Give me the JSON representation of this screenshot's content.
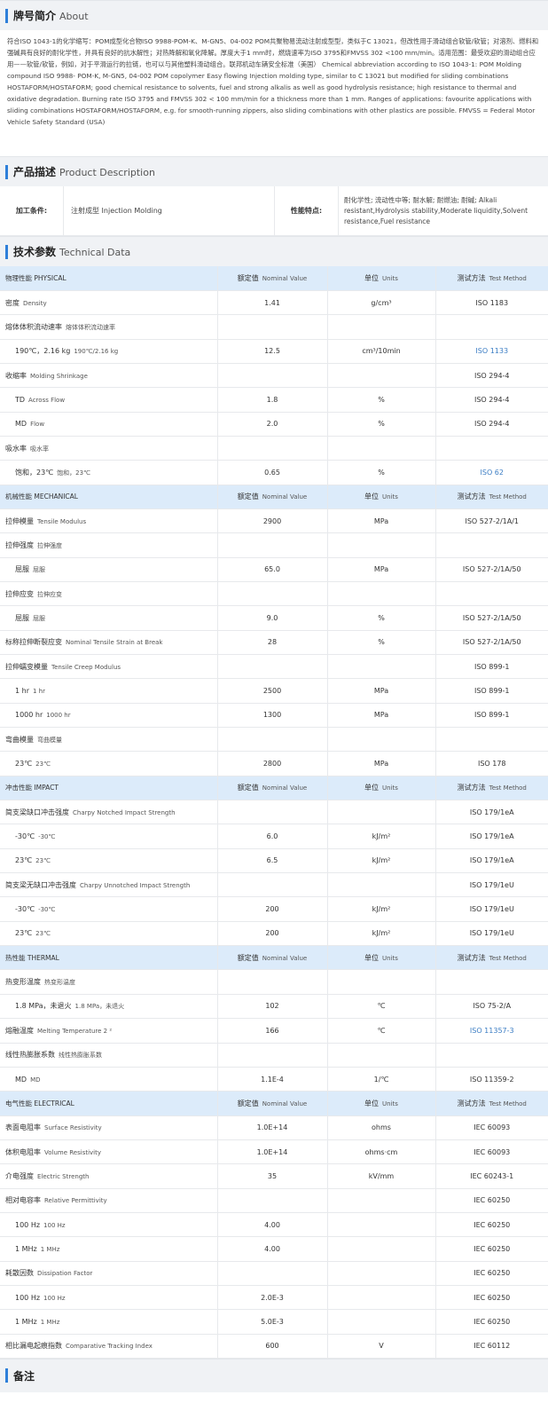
{
  "about": {
    "title": "牌号简介",
    "title_en": "About",
    "text_zh": "符合ISO 1043-1的化学缩写：POM成型化合物ISO 9988-POM-K、M-GN5、04-002 POM共聚物易流动注射成型型，类似于C 13021，但改性用于滑动组合软管/软管；对溶剂、燃料和强碱具有良好的耐化学性，并具有良好的抗水解性；对热降解和氧化降解。厚度大于1 mm时，燃烧速率为ISO 3795和FMVSS 302 <100 mm/min。适用范围：最受欢迎的滑动组合应用——软管/软管，例如，对于平滑运行的拉链，也可以与其他塑料滑动组合。联邦机动车辆安全标准（美国）",
    "text_en": "Chemical abbreviation according to ISO 1043-1: POM Molding compound ISO 9988- POM-K, M-GN5, 04-002 POM copolymer Easy flowing Injection molding type, similar to C 13021 but modified for sliding combinations HOSTAFORM/HOSTAFORM; good chemical resistance to solvents, fuel and strong alkalis as well as good hydrolysis resistance; high resistance to thermal and oxidative degradation. Burning rate ISO 3795 and FMVSS 302 < 100 mm/min for a thickness more than 1 mm. Ranges of applications: favourite applications with sliding combinations HOSTAFORM/HOSTAFORM, e.g. for smooth-running zippers, also sliding combinations with other plastics are possible. FMVSS = Federal Motor Vehicle Safety Standard (USA)"
  },
  "product": {
    "title": "产品描述",
    "title_en": "Product Description",
    "proc_label": "加工条件:",
    "proc_value": "注射成型  Injection Molding",
    "perf_label": "性能特点:",
    "perf_value": "耐化学性; 流动性中等; 耐水解; 耐燃油; 耐碱;  Alkali resistant,Hydrolysis stability,Moderate liquidity,Solvent resistance,Fuel resistance"
  },
  "tech": {
    "title": "技术参数",
    "title_en": "Technical Data",
    "rows": [
      {
        "type": "hdr",
        "c1": "物理性能  PHYSICAL",
        "c2": "额定值",
        "c2en": "Nominal Value",
        "c3": "单位",
        "c3en": "Units",
        "c4": "测试方法",
        "c4en": "Test Method"
      },
      {
        "c1": "密度",
        "c1en": "Density",
        "c2": "1.41",
        "c3": "g/cm³",
        "c4": "ISO 1183"
      },
      {
        "c1": "熔体体积流动速率",
        "c1en": "熔体体积流动速率",
        "c2": "",
        "c3": "",
        "c4": ""
      },
      {
        "ind": true,
        "c1": "190℃，2.16 kg",
        "c1en": "190℃/2.16 kg",
        "c2": "12.5",
        "c3": "cm³/10min",
        "c4": "ISO 1133",
        "link": true
      },
      {
        "c1": "收缩率",
        "c1en": "Molding Shrinkage",
        "c2": "",
        "c3": "",
        "c4": "ISO 294-4"
      },
      {
        "ind": true,
        "c1": "TD",
        "c1en": "Across Flow",
        "c2": "1.8",
        "c3": "%",
        "c4": "ISO 294-4"
      },
      {
        "ind": true,
        "c1": "MD",
        "c1en": "Flow",
        "c2": "2.0",
        "c3": "%",
        "c4": "ISO 294-4"
      },
      {
        "c1": "吸水率",
        "c1en": "吸水率",
        "c2": "",
        "c3": "",
        "c4": ""
      },
      {
        "ind": true,
        "c1": "饱和，23℃",
        "c1en": "饱和，23℃",
        "c2": "0.65",
        "c3": "%",
        "c4": "ISO 62",
        "link": true
      },
      {
        "type": "hdr",
        "c1": "机械性能  MECHANICAL",
        "c2": "额定值",
        "c2en": "Nominal Value",
        "c3": "单位",
        "c3en": "Units",
        "c4": "测试方法",
        "c4en": "Test Method"
      },
      {
        "c1": "拉伸模量",
        "c1en": "Tensile Modulus",
        "c2": "2900",
        "c3": "MPa",
        "c4": "ISO 527-2/1A/1"
      },
      {
        "c1": "拉伸强度",
        "c1en": "拉伸强度",
        "c2": "",
        "c3": "",
        "c4": ""
      },
      {
        "ind": true,
        "c1": "屈服",
        "c1en": "屈服",
        "c2": "65.0",
        "c3": "MPa",
        "c4": "ISO 527-2/1A/50"
      },
      {
        "c1": "拉伸应变",
        "c1en": "拉伸应变",
        "c2": "",
        "c3": "",
        "c4": ""
      },
      {
        "ind": true,
        "c1": "屈服",
        "c1en": "屈服",
        "c2": "9.0",
        "c3": "%",
        "c4": "ISO 527-2/1A/50"
      },
      {
        "c1": "标称拉伸断裂应变",
        "c1en": "Nominal Tensile Strain at Break",
        "c2": "28",
        "c3": "%",
        "c4": "ISO 527-2/1A/50"
      },
      {
        "c1": "拉伸蠕变模量",
        "c1en": "Tensile Creep Modulus",
        "c2": "",
        "c3": "",
        "c4": "ISO 899-1"
      },
      {
        "ind": true,
        "c1": "1 hr",
        "c1en": "1 hr",
        "c2": "2500",
        "c3": "MPa",
        "c4": "ISO 899-1"
      },
      {
        "ind": true,
        "c1": "1000 hr",
        "c1en": "1000 hr",
        "c2": "1300",
        "c3": "MPa",
        "c4": "ISO 899-1"
      },
      {
        "c1": "弯曲模量",
        "c1en": "弯曲模量",
        "c2": "",
        "c3": "",
        "c4": ""
      },
      {
        "ind": true,
        "c1": "23℃",
        "c1en": "23℃",
        "c2": "2800",
        "c3": "MPa",
        "c4": "ISO 178"
      },
      {
        "type": "hdr",
        "c1": "冲击性能  IMPACT",
        "c2": "额定值",
        "c2en": "Nominal Value",
        "c3": "单位",
        "c3en": "Units",
        "c4": "测试方法",
        "c4en": "Test Method"
      },
      {
        "c1": "简支梁缺口冲击强度",
        "c1en": "Charpy Notched Impact Strength",
        "c2": "",
        "c3": "",
        "c4": "ISO 179/1eA"
      },
      {
        "ind": true,
        "c1": "-30℃",
        "c1en": "-30℃",
        "c2": "6.0",
        "c3": "kJ/m²",
        "c4": "ISO 179/1eA"
      },
      {
        "ind": true,
        "c1": "23℃",
        "c1en": "23℃",
        "c2": "6.5",
        "c3": "kJ/m²",
        "c4": "ISO 179/1eA"
      },
      {
        "c1": "简支梁无缺口冲击强度",
        "c1en": "Charpy Unnotched Impact Strength",
        "c2": "",
        "c3": "",
        "c4": "ISO 179/1eU"
      },
      {
        "ind": true,
        "c1": "-30℃",
        "c1en": "-30℃",
        "c2": "200",
        "c3": "kJ/m²",
        "c4": "ISO 179/1eU"
      },
      {
        "ind": true,
        "c1": "23℃",
        "c1en": "23℃",
        "c2": "200",
        "c3": "kJ/m²",
        "c4": "ISO 179/1eU"
      },
      {
        "type": "hdr",
        "c1": "热性能  THERMAL",
        "c2": "额定值",
        "c2en": "Nominal Value",
        "c3": "单位",
        "c3en": "Units",
        "c4": "测试方法",
        "c4en": "Test Method"
      },
      {
        "c1": "热变形温度",
        "c1en": "热变形温度",
        "c2": "",
        "c3": "",
        "c4": ""
      },
      {
        "ind": true,
        "c1": "1.8 MPa，未退火",
        "c1en": "1.8 MPa，未退火",
        "c2": "102",
        "c3": "℃",
        "c4": "ISO 75-2/A"
      },
      {
        "c1": "熔融温度",
        "c1en": "Melting Temperature  2 ²",
        "c2": "166",
        "c3": "℃",
        "c4": "ISO 11357-3",
        "link": true
      },
      {
        "c1": "线性热膨胀系数",
        "c1en": "线性热膨胀系数",
        "c2": "",
        "c3": "",
        "c4": ""
      },
      {
        "ind": true,
        "c1": "MD",
        "c1en": "MD",
        "c2": "1.1E-4",
        "c3": "1/℃",
        "c4": "ISO 11359-2"
      },
      {
        "type": "hdr",
        "c1": "电气性能  ELECTRICAL",
        "c2": "额定值",
        "c2en": "Nominal Value",
        "c3": "单位",
        "c3en": "Units",
        "c4": "测试方法",
        "c4en": "Test Method"
      },
      {
        "c1": "表面电阻率",
        "c1en": "Surface Resistivity",
        "c2": "1.0E+14",
        "c3": "ohms",
        "c4": "IEC 60093"
      },
      {
        "c1": "体积电阻率",
        "c1en": "Volume Resistivity",
        "c2": "1.0E+14",
        "c3": "ohms·cm",
        "c4": "IEC 60093"
      },
      {
        "c1": "介电强度",
        "c1en": "Electric Strength",
        "c2": "35",
        "c3": "kV/mm",
        "c4": "IEC 60243-1"
      },
      {
        "c1": "相对电容率",
        "c1en": "Relative Permittivity",
        "c2": "",
        "c3": "",
        "c4": "IEC 60250"
      },
      {
        "ind": true,
        "c1": "100 Hz",
        "c1en": "100 Hz",
        "c2": "4.00",
        "c3": "",
        "c4": "IEC 60250"
      },
      {
        "ind": true,
        "c1": "1 MHz",
        "c1en": "1 MHz",
        "c2": "4.00",
        "c3": "",
        "c4": "IEC 60250"
      },
      {
        "c1": "耗散因数",
        "c1en": "Dissipation Factor",
        "c2": "",
        "c3": "",
        "c4": "IEC 60250"
      },
      {
        "ind": true,
        "c1": "100 Hz",
        "c1en": "100 Hz",
        "c2": "2.0E-3",
        "c3": "",
        "c4": "IEC 60250"
      },
      {
        "ind": true,
        "c1": "1 MHz",
        "c1en": "1 MHz",
        "c2": "5.0E-3",
        "c3": "",
        "c4": "IEC 60250"
      },
      {
        "c1": "相比漏电起痕指数",
        "c1en": "Comparative Tracking Index",
        "c2": "600",
        "c3": "V",
        "c4": "IEC 60112"
      }
    ]
  },
  "notes": {
    "title": "备注"
  },
  "colors": {
    "accent": "#2e7fd9",
    "header_row": "#dcebfa",
    "section_bg": "#f0f2f5",
    "link": "#3b7dc4"
  }
}
